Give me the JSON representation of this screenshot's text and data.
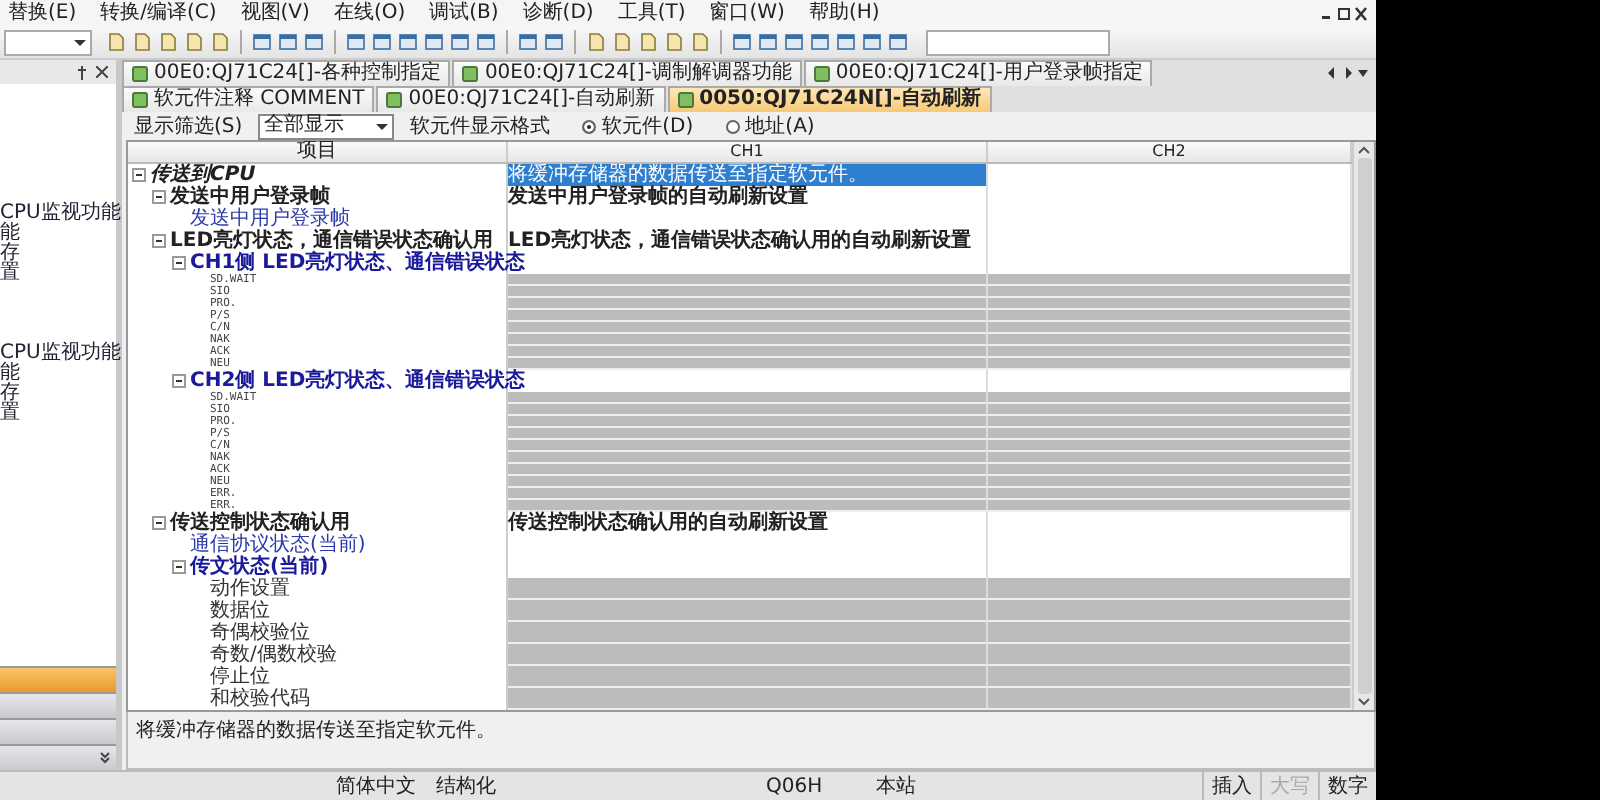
{
  "menu": [
    "替换(E)",
    "转换/编译(C)",
    "视图(V)",
    "在线(O)",
    "调试(B)",
    "诊断(D)",
    "工具(T)",
    "窗口(W)",
    "帮助(H)"
  ],
  "sidebar": {
    "groups": [
      {
        "items": [
          "CPU监视功能",
          "能",
          "存",
          "置"
        ]
      },
      {
        "items": [
          "CPU监视功能",
          "能",
          "存",
          "置"
        ]
      }
    ]
  },
  "tabs": [
    {
      "label": "00E0:QJ71C24[]-各种控制指定",
      "selected": false
    },
    {
      "label": "00E0:QJ71C24[]-调制解调器功能",
      "selected": false
    },
    {
      "label": "00E0:QJ71C24[]-用户登录帧指定",
      "selected": false
    },
    {
      "label": "软元件注释 COMMENT",
      "selected": false
    },
    {
      "label": "00E0:QJ71C24[]-自动刷新",
      "selected": false
    },
    {
      "label": "0050:QJ71C24N[]-自动刷新",
      "selected": true
    }
  ],
  "filter": {
    "label": "显示筛选(S)",
    "value": "全部显示",
    "format_label": "软元件显示格式",
    "options": [
      {
        "label": "软元件(D)",
        "selected": true
      },
      {
        "label": "地址(A)",
        "selected": false
      }
    ]
  },
  "table": {
    "columns": [
      "项目",
      "CH1",
      "CH2"
    ],
    "tree": [
      {
        "label": "传送到CPU",
        "kind": "root",
        "expanded": true,
        "selected": true,
        "ch1": "将缓冲存储器的数据传送至指定软元件。",
        "children": [
          {
            "label": "发送中用户登录帧",
            "kind": "category",
            "expanded": true,
            "selected": false,
            "ch1": "发送中用户登录帧的自动刷新设置",
            "children": [
              {
                "label": "发送中用户登录帧",
                "kind": "link",
                "selected": false
              }
            ]
          },
          {
            "label": "LED亮灯状态，通信错误状态确认用",
            "kind": "category",
            "expanded": true,
            "selected": false,
            "ch1": "LED亮灯状态，通信错误状态确认用的自动刷新设置",
            "children": [
              {
                "label": "CH1侧 LED亮灯状态、通信错误状态",
                "kind": "heading",
                "expanded": true,
                "selected": false,
                "children": [
                  {
                    "label": "SD.WAIT",
                    "kind": "device",
                    "selected": false
                  },
                  {
                    "label": "SIO",
                    "kind": "device",
                    "selected": false
                  },
                  {
                    "label": "PRO.",
                    "kind": "device",
                    "selected": false
                  },
                  {
                    "label": "P/S",
                    "kind": "device",
                    "selected": false
                  },
                  {
                    "label": "C/N",
                    "kind": "device",
                    "selected": false
                  },
                  {
                    "label": "NAK",
                    "kind": "device",
                    "selected": false
                  },
                  {
                    "label": "ACK",
                    "kind": "device",
                    "selected": false
                  },
                  {
                    "label": "NEU",
                    "kind": "device",
                    "selected": false
                  }
                ]
              },
              {
                "label": "CH2侧 LED亮灯状态、通信错误状态",
                "kind": "heading",
                "expanded": true,
                "selected": false,
                "children": [
                  {
                    "label": "SD.WAIT",
                    "kind": "device",
                    "selected": false
                  },
                  {
                    "label": "SIO",
                    "kind": "device",
                    "selected": false
                  },
                  {
                    "label": "PRO.",
                    "kind": "device",
                    "selected": false
                  },
                  {
                    "label": "P/S",
                    "kind": "device",
                    "selected": false
                  },
                  {
                    "label": "C/N",
                    "kind": "device",
                    "selected": false
                  },
                  {
                    "label": "NAK",
                    "kind": "device",
                    "selected": false
                  },
                  {
                    "label": "ACK",
                    "kind": "device",
                    "selected": false
                  },
                  {
                    "label": "NEU",
                    "kind": "device",
                    "selected": false
                  },
                  {
                    "label": "ERR.",
                    "kind": "device",
                    "selected": false
                  },
                  {
                    "label": "ERR.",
                    "kind": "device",
                    "selected": false
                  }
                ]
              }
            ]
          },
          {
            "label": "传送控制状态确认用",
            "kind": "category",
            "expanded": true,
            "selected": false,
            "ch1": "传送控制状态确认用的自动刷新设置",
            "children": [
              {
                "label": "通信协议状态(当前)",
                "kind": "link",
                "selected": false
              },
              {
                "label": "传文状态(当前)",
                "kind": "heading",
                "expanded": true,
                "selected": false,
                "children": [
                  {
                    "label": "动作设置",
                    "kind": "field",
                    "selected": false
                  },
                  {
                    "label": "数据位",
                    "kind": "field",
                    "selected": false
                  },
                  {
                    "label": "奇偶校验位",
                    "kind": "field",
                    "selected": false
                  },
                  {
                    "label": "奇数/偶数校验",
                    "kind": "field",
                    "selected": false
                  },
                  {
                    "label": "停止位",
                    "kind": "field",
                    "selected": false
                  },
                  {
                    "label": "和校验代码",
                    "kind": "field",
                    "selected": false
                  }
                ]
              }
            ]
          }
        ]
      }
    ]
  },
  "description": "将缓冲存储器的数据传送至指定软元件。",
  "status_bar": {
    "segments": [
      "简体中文",
      "结构化",
      "Q06H",
      "本站"
    ],
    "indicators": [
      {
        "text": "插入",
        "on": true
      },
      {
        "text": "大写",
        "on": false
      },
      {
        "text": "数字",
        "on": true
      }
    ]
  }
}
